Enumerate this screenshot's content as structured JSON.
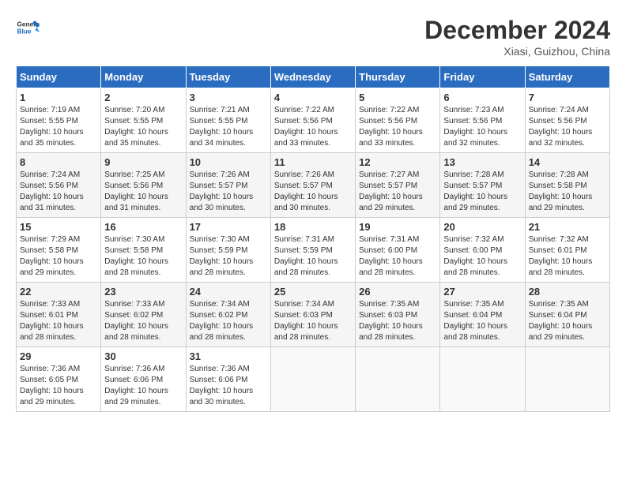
{
  "header": {
    "logo_line1": "General",
    "logo_line2": "Blue",
    "month_title": "December 2024",
    "location": "Xiasi, Guizhou, China"
  },
  "calendar": {
    "days_of_week": [
      "Sunday",
      "Monday",
      "Tuesday",
      "Wednesday",
      "Thursday",
      "Friday",
      "Saturday"
    ],
    "weeks": [
      [
        null,
        null,
        null,
        null,
        null,
        null,
        null
      ]
    ],
    "cells": [
      {
        "day": null,
        "info": null
      },
      {
        "day": null,
        "info": null
      },
      {
        "day": null,
        "info": null
      },
      {
        "day": null,
        "info": null
      },
      {
        "day": null,
        "info": null
      },
      {
        "day": null,
        "info": null
      },
      {
        "day": null,
        "info": null
      }
    ],
    "rows": [
      [
        {
          "day": "1",
          "sunrise": "Sunrise: 7:19 AM",
          "sunset": "Sunset: 5:55 PM",
          "daylight": "Daylight: 10 hours and 35 minutes."
        },
        {
          "day": "2",
          "sunrise": "Sunrise: 7:20 AM",
          "sunset": "Sunset: 5:55 PM",
          "daylight": "Daylight: 10 hours and 35 minutes."
        },
        {
          "day": "3",
          "sunrise": "Sunrise: 7:21 AM",
          "sunset": "Sunset: 5:55 PM",
          "daylight": "Daylight: 10 hours and 34 minutes."
        },
        {
          "day": "4",
          "sunrise": "Sunrise: 7:22 AM",
          "sunset": "Sunset: 5:56 PM",
          "daylight": "Daylight: 10 hours and 33 minutes."
        },
        {
          "day": "5",
          "sunrise": "Sunrise: 7:22 AM",
          "sunset": "Sunset: 5:56 PM",
          "daylight": "Daylight: 10 hours and 33 minutes."
        },
        {
          "day": "6",
          "sunrise": "Sunrise: 7:23 AM",
          "sunset": "Sunset: 5:56 PM",
          "daylight": "Daylight: 10 hours and 32 minutes."
        },
        {
          "day": "7",
          "sunrise": "Sunrise: 7:24 AM",
          "sunset": "Sunset: 5:56 PM",
          "daylight": "Daylight: 10 hours and 32 minutes."
        }
      ],
      [
        {
          "day": "8",
          "sunrise": "Sunrise: 7:24 AM",
          "sunset": "Sunset: 5:56 PM",
          "daylight": "Daylight: 10 hours and 31 minutes."
        },
        {
          "day": "9",
          "sunrise": "Sunrise: 7:25 AM",
          "sunset": "Sunset: 5:56 PM",
          "daylight": "Daylight: 10 hours and 31 minutes."
        },
        {
          "day": "10",
          "sunrise": "Sunrise: 7:26 AM",
          "sunset": "Sunset: 5:57 PM",
          "daylight": "Daylight: 10 hours and 30 minutes."
        },
        {
          "day": "11",
          "sunrise": "Sunrise: 7:26 AM",
          "sunset": "Sunset: 5:57 PM",
          "daylight": "Daylight: 10 hours and 30 minutes."
        },
        {
          "day": "12",
          "sunrise": "Sunrise: 7:27 AM",
          "sunset": "Sunset: 5:57 PM",
          "daylight": "Daylight: 10 hours and 29 minutes."
        },
        {
          "day": "13",
          "sunrise": "Sunrise: 7:28 AM",
          "sunset": "Sunset: 5:57 PM",
          "daylight": "Daylight: 10 hours and 29 minutes."
        },
        {
          "day": "14",
          "sunrise": "Sunrise: 7:28 AM",
          "sunset": "Sunset: 5:58 PM",
          "daylight": "Daylight: 10 hours and 29 minutes."
        }
      ],
      [
        {
          "day": "15",
          "sunrise": "Sunrise: 7:29 AM",
          "sunset": "Sunset: 5:58 PM",
          "daylight": "Daylight: 10 hours and 29 minutes."
        },
        {
          "day": "16",
          "sunrise": "Sunrise: 7:30 AM",
          "sunset": "Sunset: 5:58 PM",
          "daylight": "Daylight: 10 hours and 28 minutes."
        },
        {
          "day": "17",
          "sunrise": "Sunrise: 7:30 AM",
          "sunset": "Sunset: 5:59 PM",
          "daylight": "Daylight: 10 hours and 28 minutes."
        },
        {
          "day": "18",
          "sunrise": "Sunrise: 7:31 AM",
          "sunset": "Sunset: 5:59 PM",
          "daylight": "Daylight: 10 hours and 28 minutes."
        },
        {
          "day": "19",
          "sunrise": "Sunrise: 7:31 AM",
          "sunset": "Sunset: 6:00 PM",
          "daylight": "Daylight: 10 hours and 28 minutes."
        },
        {
          "day": "20",
          "sunrise": "Sunrise: 7:32 AM",
          "sunset": "Sunset: 6:00 PM",
          "daylight": "Daylight: 10 hours and 28 minutes."
        },
        {
          "day": "21",
          "sunrise": "Sunrise: 7:32 AM",
          "sunset": "Sunset: 6:01 PM",
          "daylight": "Daylight: 10 hours and 28 minutes."
        }
      ],
      [
        {
          "day": "22",
          "sunrise": "Sunrise: 7:33 AM",
          "sunset": "Sunset: 6:01 PM",
          "daylight": "Daylight: 10 hours and 28 minutes."
        },
        {
          "day": "23",
          "sunrise": "Sunrise: 7:33 AM",
          "sunset": "Sunset: 6:02 PM",
          "daylight": "Daylight: 10 hours and 28 minutes."
        },
        {
          "day": "24",
          "sunrise": "Sunrise: 7:34 AM",
          "sunset": "Sunset: 6:02 PM",
          "daylight": "Daylight: 10 hours and 28 minutes."
        },
        {
          "day": "25",
          "sunrise": "Sunrise: 7:34 AM",
          "sunset": "Sunset: 6:03 PM",
          "daylight": "Daylight: 10 hours and 28 minutes."
        },
        {
          "day": "26",
          "sunrise": "Sunrise: 7:35 AM",
          "sunset": "Sunset: 6:03 PM",
          "daylight": "Daylight: 10 hours and 28 minutes."
        },
        {
          "day": "27",
          "sunrise": "Sunrise: 7:35 AM",
          "sunset": "Sunset: 6:04 PM",
          "daylight": "Daylight: 10 hours and 28 minutes."
        },
        {
          "day": "28",
          "sunrise": "Sunrise: 7:35 AM",
          "sunset": "Sunset: 6:04 PM",
          "daylight": "Daylight: 10 hours and 29 minutes."
        }
      ],
      [
        {
          "day": "29",
          "sunrise": "Sunrise: 7:36 AM",
          "sunset": "Sunset: 6:05 PM",
          "daylight": "Daylight: 10 hours and 29 minutes."
        },
        {
          "day": "30",
          "sunrise": "Sunrise: 7:36 AM",
          "sunset": "Sunset: 6:06 PM",
          "daylight": "Daylight: 10 hours and 29 minutes."
        },
        {
          "day": "31",
          "sunrise": "Sunrise: 7:36 AM",
          "sunset": "Sunset: 6:06 PM",
          "daylight": "Daylight: 10 hours and 30 minutes."
        },
        null,
        null,
        null,
        null
      ]
    ]
  }
}
